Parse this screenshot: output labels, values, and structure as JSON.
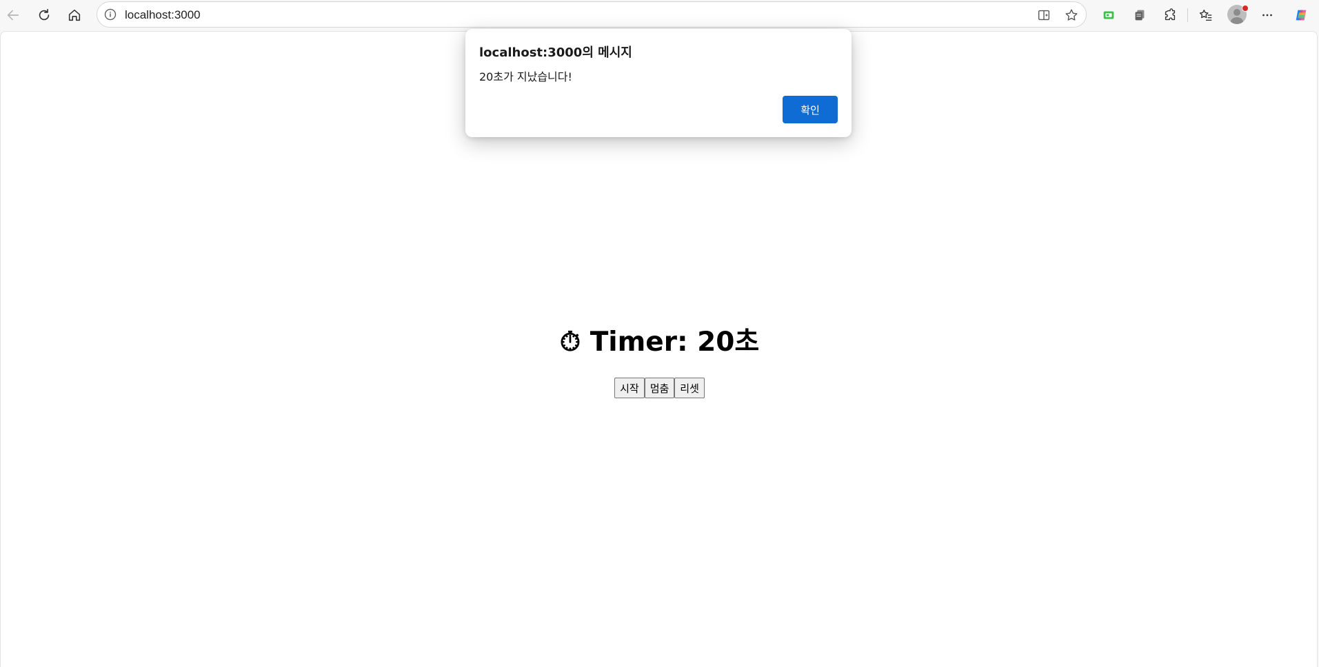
{
  "browser": {
    "url": "localhost:3000",
    "icons": {
      "back": "back-arrow-icon",
      "refresh": "refresh-icon",
      "home": "home-icon",
      "info": "site-info-icon",
      "split_screen": "split-screen-icon",
      "favorite": "star-icon",
      "collections_extension": "green-extension-icon",
      "copy_extension": "copy-extension-icon",
      "extensions": "puzzle-icon",
      "favorites_bar": "favorites-icon",
      "profile": "profile-avatar-icon",
      "more": "more-icon",
      "copilot": "copilot-icon"
    }
  },
  "page": {
    "timer_icon": "⏱",
    "timer_text": "Timer: 20초",
    "buttons": {
      "start": "시작",
      "stop": "멈춤",
      "reset": "리셋"
    }
  },
  "dialog": {
    "title": "localhost:3000의 메시지",
    "message": "20초가 지났습니다!",
    "ok_label": "확인",
    "accent_color": "#0f6cd4"
  }
}
